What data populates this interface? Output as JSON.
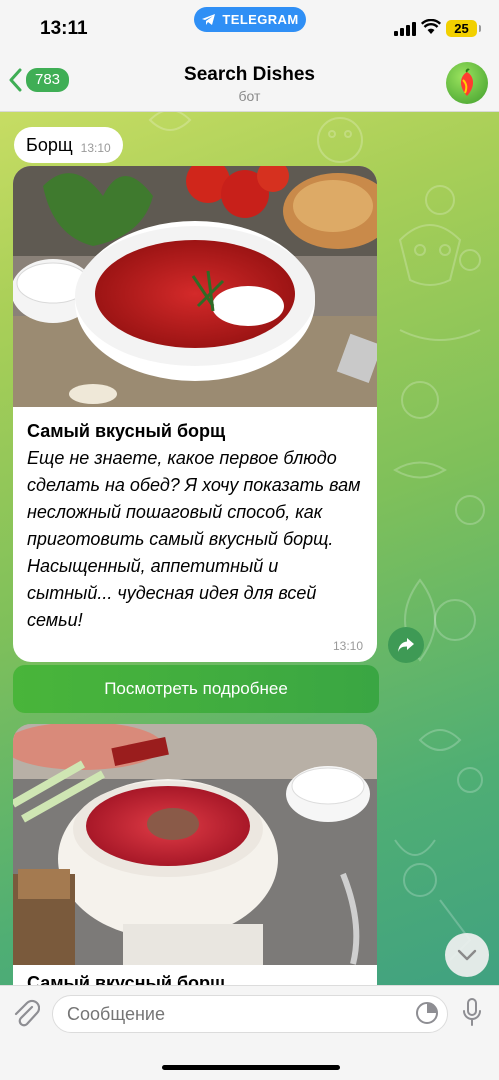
{
  "status_bar": {
    "time": "13:11",
    "app_pill": "TELEGRAM",
    "battery": "25",
    "icons": [
      "telegram-icon",
      "signal-icon",
      "wifi-icon",
      "battery-icon"
    ]
  },
  "header": {
    "back_count": "783",
    "title": "Search Dishes",
    "subtitle": "бот"
  },
  "messages": {
    "outgoing": {
      "text": "Борщ",
      "time": "13:10"
    },
    "card1": {
      "title": "Самый вкусный борщ",
      "description": "Еще не знаете, какое первое блюдо сделать на обед? Я хочу показать вам несложный пошаговый способ, как приготовить самый вкусный борщ. Насыщенный, аппетитный и сытный... чудесная идея для всей семьи!",
      "time": "13:10",
      "button_label": "Посмотреть подробнее"
    },
    "card2": {
      "title": "Самый вкусный борщ"
    }
  },
  "input": {
    "placeholder": "Сообщение"
  },
  "colors": {
    "accent_green": "#3fae55",
    "telegram_blue": "#2f8ff5",
    "battery_yellow": "#f2d000"
  }
}
